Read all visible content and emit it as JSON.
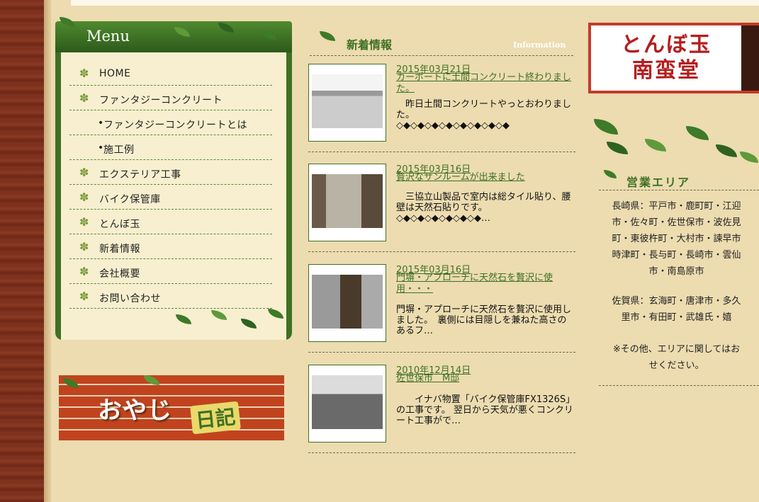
{
  "menu": {
    "title": "Menu",
    "items": [
      {
        "label": "HOME",
        "sub": false
      },
      {
        "label": "ファンタジーコンクリート",
        "sub": false
      },
      {
        "label": "ファンタジーコンクリートとは",
        "sub": true
      },
      {
        "label": "施工例",
        "sub": true
      },
      {
        "label": "エクステリア工事",
        "sub": false
      },
      {
        "label": "バイク保管庫",
        "sub": false
      },
      {
        "label": "とんぼ玉",
        "sub": false
      },
      {
        "label": "新着情報",
        "sub": false
      },
      {
        "label": "会社概要",
        "sub": false
      },
      {
        "label": "お問い合わせ",
        "sub": false
      }
    ]
  },
  "banner": {
    "main": "おやじ",
    "sub": "日記"
  },
  "news": {
    "title": "新着情報",
    "subtitle": "Information",
    "items": [
      {
        "date": "2015年03月21日",
        "title": "カーポートに土間コンクリート終わりました。",
        "excerpt": "　昨日土間コンクリートやっとおわりました。",
        "marks": "◇◆◇◆◇◆◇◆◇◆◇◆◇◆◇◆"
      },
      {
        "date": "2015年03月16日",
        "title": "贅沢なサンルームが出来ました",
        "excerpt": "　三協立山製品で室内は総タイル貼り、腰壁は天然石貼りです。",
        "marks": "◇◆◇◆◇◆◇◆◇◆◇◆…"
      },
      {
        "date": "2015年03月16日",
        "title": "門塀・アプローチに天然石を贅沢に使用・・・",
        "excerpt": "門塀・アプローチに天然石を贅沢に使用しました。　裏側には目隠しを兼ねた高さのあるフ…",
        "marks": ""
      },
      {
        "date": "2010年12月14日",
        "title": "佐世保市　M邸",
        "excerpt": "　　イナバ物置「バイク保管庫FX1326S」の工事です。 翌日から天気が悪くコンクリート工事がで…",
        "marks": ""
      }
    ]
  },
  "shop": {
    "line1": "とんぼ玉",
    "line2": "南蛮堂"
  },
  "area": {
    "title": "営業エリア",
    "nagasaki": [
      "長崎県：平戸市・鹿町町・江迎",
      "市・佐々町・佐世保市・波佐見",
      "町・東彼杵町・大村市・諫早市",
      "時津町・長与町・長崎市・雲仙",
      "市・南島原市"
    ],
    "saga": [
      "佐賀県：玄海町・唐津市・多久",
      "里市・有田町・武雄氏・嬉"
    ],
    "note": [
      "※その他、エリアに関してはお",
      "せください。"
    ]
  }
}
